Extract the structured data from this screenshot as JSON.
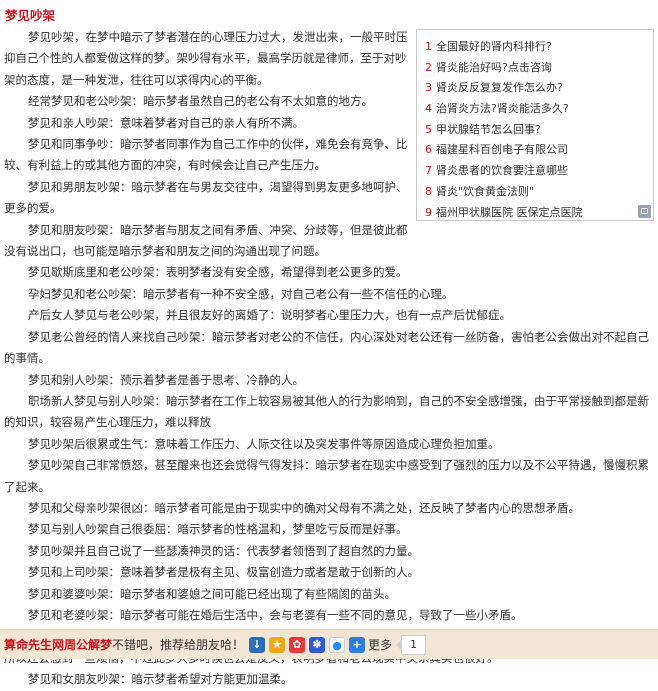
{
  "title": "梦见吵架",
  "sidebar": {
    "items": [
      {
        "num": "1",
        "label": "全国最好的肾内科排行?"
      },
      {
        "num": "2",
        "label": "肾炎能治好吗?点击咨询"
      },
      {
        "num": "3",
        "label": "肾炎反反复复发作怎么办?"
      },
      {
        "num": "4",
        "label": "治肾炎方法?肾炎能活多久?"
      },
      {
        "num": "5",
        "label": "甲状腺结节怎么回事?"
      },
      {
        "num": "6",
        "label": "福建星科百创电子有限公司"
      },
      {
        "num": "7",
        "label": "肾炎患者的饮食要注意哪些"
      },
      {
        "num": "8",
        "label": "肾炎\"饮食黄金法则\""
      },
      {
        "num": "9",
        "label": "福州甲状腺医院 医保定点医院"
      }
    ]
  },
  "paragraphs": [
    "梦见吵架，在梦中暗示了梦者潜在的心理压力过大，发泄出来，一般平时压抑自己个性的人都爱做这样的梦。架吵得有水平，最高学历就是律师，至于对吵架的态度，是一种发泄，往往可以求得内心的平衡。",
    "经常梦见和老公吵架：暗示梦者虽然自己的老公有不太如意的地方。",
    "梦见和亲人吵架：意味着梦者对自己的亲人有所不满。",
    "梦见和同事争吵：暗示梦者同事作为自己工作中的伙伴，难免会有竞争、比较、有利益上的或其他方面的冲突，有时候会让自己产生压力。",
    "梦见和男朋友吵架：暗示梦者在与男友交往中，渴望得到男友更多地呵护、更多的爱。",
    "梦见和朋友吵架：暗示梦者与朋友之间有矛盾、冲突、分歧等，但是彼此都没有说出口，也可能是暗示梦者和朋友之间的沟通出现了问题。",
    "梦见歇斯底里和老公吵架：表明梦者没有安全感，希望得到老公更多的爱。",
    "孕妇梦见和老公吵架：暗示梦者有一种不安全感，对自己老公有一些不信任的心理。",
    "产后女人梦见与老公吵架，并且很友好的离婚了：说明梦者心里压力大，也有一点产后忧郁症。",
    "梦见老公曾经的情人来找自己吵架：暗示梦者对老公的不信任，内心深处对老公还有一丝防备，害怕老公会做出对不起自己的事情。",
    "梦见和别人吵架：预示着梦者是善于思考、冷静的人。",
    "职场新人梦见与别人吵架：暗示梦者在工作上较容易被其他人的行为影响到，自己的不安全感增强，由于平常接触到都是新的知识，较容易产生心理压力，难以释放",
    "梦见吵架后很累或生气：意味着工作压力、人际交往以及突发事件等原因造成心理负担加重。",
    "梦见吵架自己非常愤怒，甚至醒来也还会觉得气得发抖：暗示梦者在现实中感受到了强烈的压力以及不公平待遇，慢慢积累了起来。",
    "梦见和父母亲吵架很凶：暗示梦者可能是由于现实中的确对父母有不满之处，还反映了梦者内心的思想矛盾。",
    "梦见与别人吵架自己很委屈：暗示梦者的性格温和，梦里吃亏反而是好事。",
    "梦见吵架并且自己说了一些瑟凑神灵的话：代表梦者领悟到了超自然的力量。",
    "梦见和上司吵架：意味着梦者是极有主见、极富创造力或者是敢于创新的人。",
    "梦见和婆婆吵架：暗示梦者和婆媳之间可能已经出现了有些隔阂的苗头。",
    "梦见和老婆吵架：暗示梦者可能在婚后生活中，会与老婆有一些不同的意见，导致了一些小矛盾。",
    "梦见和老公吵架：表示梦者对某件家庭琐事儿该怎么处理才能达到最好的效果，还尚未理清头绪，所以还会感到一些烦恼，所以还会感到一些烦恼，不过此梦大多时候也会是反义，表明梦者和老公现实中关系其实也很好。",
    "梦见和女朋友吵架：暗示梦者希望对方能更加温柔。"
  ],
  "footer": {
    "brand": "算命先生网周公解梦",
    "recommend": "不错吧，推荐给朋友哈！",
    "more_label": "更多",
    "count": "1",
    "icons": [
      "qzone-icon",
      "star-icon",
      "weibo-icon",
      "baidu-icon",
      "qq-icon",
      "more-plus-icon"
    ]
  }
}
